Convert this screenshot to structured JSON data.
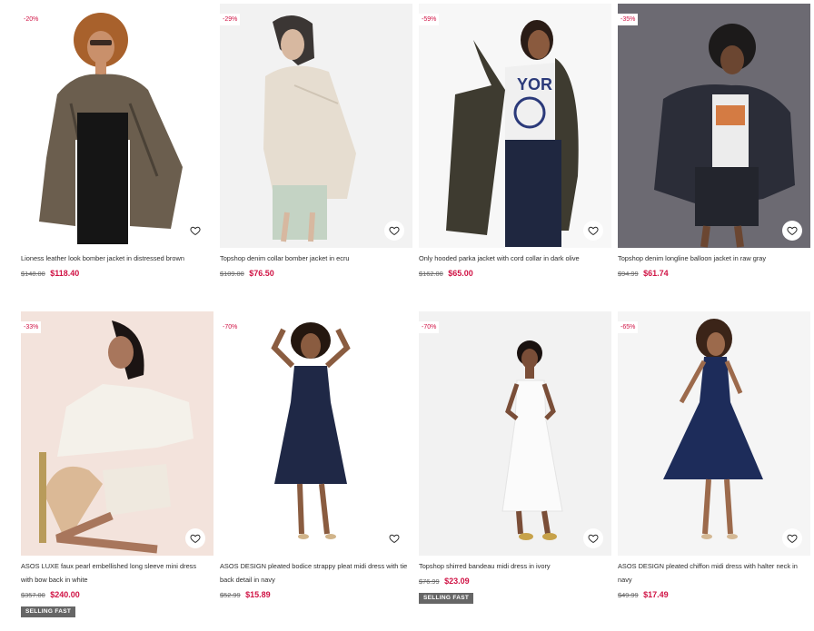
{
  "products": [
    {
      "discount": "-20%",
      "title": "Lioness leather look bomber jacket in distressed brown",
      "old_price": "$148.00",
      "new_price": "$118.40",
      "badge": ""
    },
    {
      "discount": "-29%",
      "title": "Topshop denim collar bomber jacket in ecru",
      "old_price": "$109.00",
      "new_price": "$76.50",
      "badge": ""
    },
    {
      "discount": "-59%",
      "title": "Only hooded parka jacket with cord collar in dark olive",
      "old_price": "$162.00",
      "new_price": "$65.00",
      "badge": ""
    },
    {
      "discount": "-35%",
      "title": "Topshop denim longline balloon jacket in raw gray",
      "old_price": "$94.99",
      "new_price": "$61.74",
      "badge": ""
    },
    {
      "discount": "-33%",
      "title": "ASOS LUXE faux pearl embellished long sleeve mini dress with bow back in white",
      "old_price": "$357.00",
      "new_price": "$240.00",
      "badge": "SELLING FAST"
    },
    {
      "discount": "-70%",
      "title": "ASOS DESIGN pleated bodice strappy pleat midi dress with tie back detail in navy",
      "old_price": "$52.99",
      "new_price": "$15.89",
      "badge": ""
    },
    {
      "discount": "-70%",
      "title": "Topshop shirred bandeau midi dress in ivory",
      "old_price": "$76.99",
      "new_price": "$23.09",
      "badge": "SELLING FAST"
    },
    {
      "discount": "-65%",
      "title": "ASOS DESIGN pleated chiffon midi dress with halter neck in navy",
      "old_price": "$49.99",
      "new_price": "$17.49",
      "badge": ""
    }
  ],
  "colors": {
    "sale": "#d01345",
    "badge_bg": "#666666"
  },
  "icons": {
    "save": "heart-icon"
  }
}
